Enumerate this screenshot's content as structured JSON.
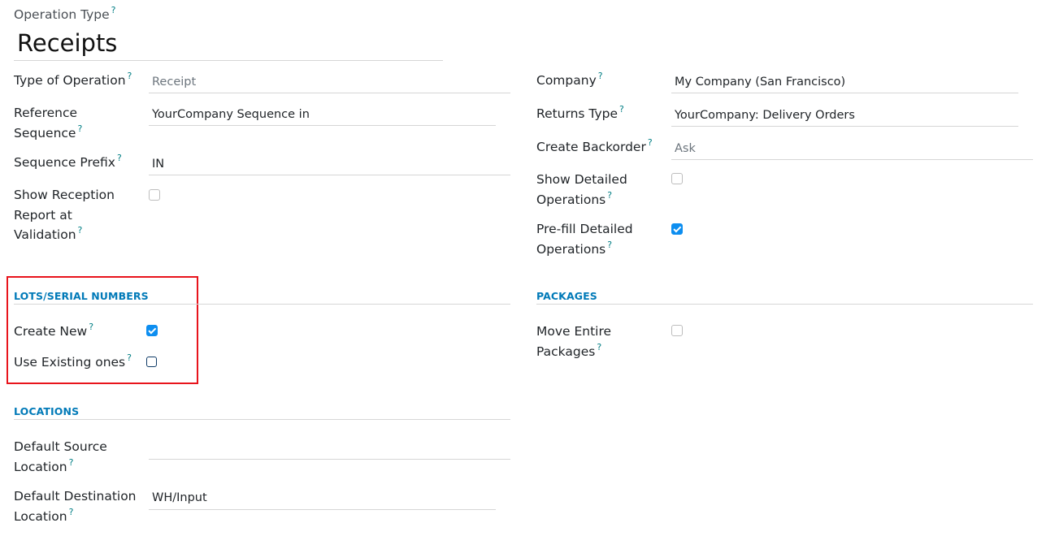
{
  "header": {
    "operation_type_label": "Operation Type",
    "help_mark": "?",
    "title": "Receipts"
  },
  "left_fields": {
    "type_of_operation": {
      "label": "Type of Operation",
      "value": "Receipt"
    },
    "reference_sequence": {
      "label_line1": "Reference",
      "label_line2": "Sequence",
      "value": "YourCompany Sequence in"
    },
    "sequence_prefix": {
      "label": "Sequence Prefix",
      "value": "IN"
    },
    "show_reception_report": {
      "label_line1": "Show Reception",
      "label_line2": "Report at",
      "label_line3": "Validation",
      "checked": false
    }
  },
  "right_fields": {
    "company": {
      "label": "Company",
      "value": "My Company (San Francisco)"
    },
    "returns_type": {
      "label": "Returns Type",
      "value": "YourCompany: Delivery Orders"
    },
    "create_backorder": {
      "label": "Create Backorder",
      "value": "Ask"
    },
    "show_detailed_operations": {
      "label_line1": "Show Detailed",
      "label_line2": "Operations",
      "checked": false
    },
    "prefill_detailed_operations": {
      "label_line1": "Pre-fill Detailed",
      "label_line2": "Operations",
      "checked": true
    }
  },
  "lots_section": {
    "title": "LOTS/SERIAL NUMBERS",
    "create_new": {
      "label": "Create New",
      "checked": true
    },
    "use_existing": {
      "label": "Use Existing ones",
      "checked": false
    }
  },
  "packages_section": {
    "title": "PACKAGES",
    "move_entire_packages": {
      "label_line1": "Move Entire",
      "label_line2": "Packages",
      "checked": false
    }
  },
  "locations_section": {
    "title": "LOCATIONS",
    "default_source": {
      "label_line1": "Default Source",
      "label_line2": "Location",
      "value": ""
    },
    "default_destination": {
      "label_line1": "Default Destination",
      "label_line2": "Location",
      "value": "WH/Input"
    }
  },
  "colors": {
    "accent": "#017ab8",
    "help": "#017e84",
    "checkbox_checked": "#0d8ef0",
    "highlight_box": "#e8141c"
  }
}
